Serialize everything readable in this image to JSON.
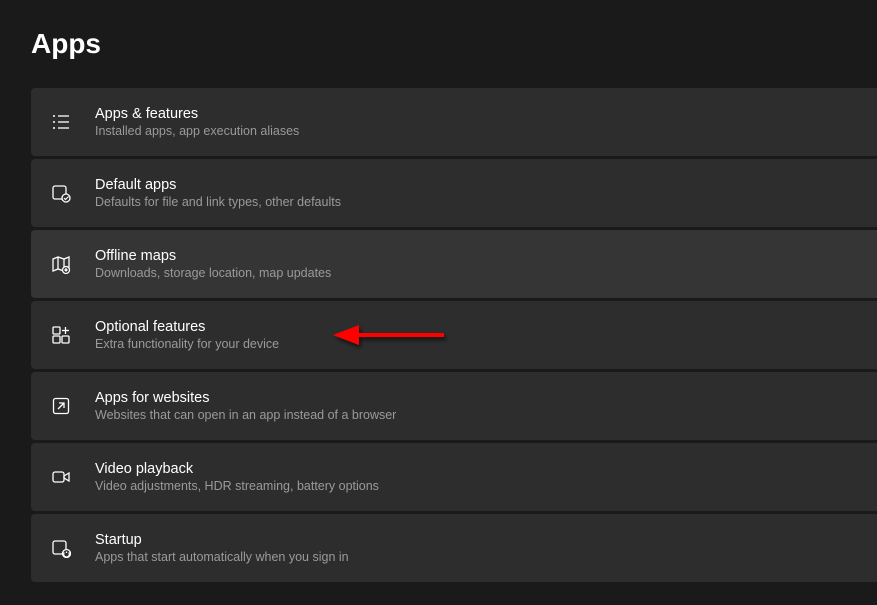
{
  "page": {
    "title": "Apps"
  },
  "items": [
    {
      "icon": "list-icon",
      "title": "Apps & features",
      "desc": "Installed apps, app execution aliases"
    },
    {
      "icon": "default-apps-icon",
      "title": "Default apps",
      "desc": "Defaults for file and link types, other defaults"
    },
    {
      "icon": "map-icon",
      "title": "Offline maps",
      "desc": "Downloads, storage location, map updates"
    },
    {
      "icon": "optional-features-icon",
      "title": "Optional features",
      "desc": "Extra functionality for your device"
    },
    {
      "icon": "apps-websites-icon",
      "title": "Apps for websites",
      "desc": "Websites that can open in an app instead of a browser"
    },
    {
      "icon": "video-icon",
      "title": "Video playback",
      "desc": "Video adjustments, HDR streaming, battery options"
    },
    {
      "icon": "startup-icon",
      "title": "Startup",
      "desc": "Apps that start automatically when you sign in"
    }
  ],
  "annotation": {
    "target_index": 3,
    "color": "#ff0000"
  }
}
